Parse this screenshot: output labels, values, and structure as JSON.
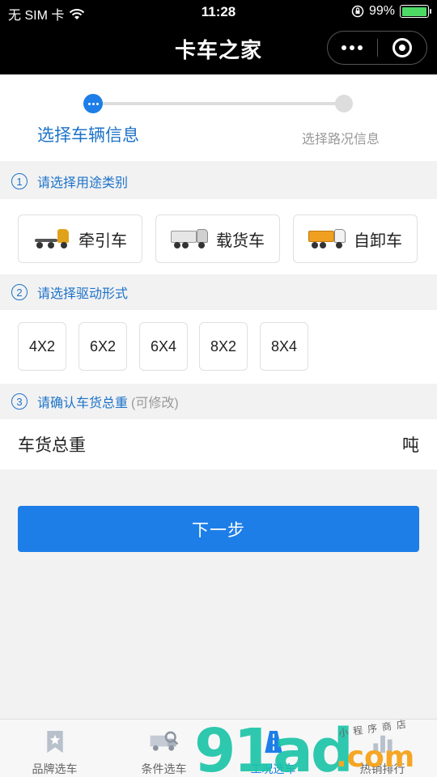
{
  "status_bar": {
    "carrier": "无 SIM 卡",
    "time": "11:28",
    "battery": "99%",
    "battery_level": 0.99
  },
  "nav": {
    "title": "卡车之家"
  },
  "steps": {
    "step1": "选择车辆信息",
    "step2": "选择路况信息",
    "current": 1
  },
  "section1": {
    "number": "①",
    "title": "请选择用途类别",
    "options": [
      {
        "label": "牵引车",
        "icon": "tractor-truck-icon"
      },
      {
        "label": "载货车",
        "icon": "cargo-truck-icon"
      },
      {
        "label": "自卸车",
        "icon": "dump-truck-icon"
      }
    ]
  },
  "section2": {
    "number": "②",
    "title": "请选择驱动形式",
    "options": [
      "4X2",
      "6X2",
      "6X4",
      "8X2",
      "8X4"
    ]
  },
  "section3": {
    "number": "③",
    "title": "请确认车货总重",
    "hint": "(可修改)",
    "field_label": "车货总重",
    "field_value": "",
    "unit": "吨"
  },
  "next_button": "下一步",
  "tabbar": [
    {
      "label": "品牌选车",
      "icon": "bookmark-star-icon"
    },
    {
      "label": "条件选车",
      "icon": "truck-search-icon"
    },
    {
      "label": "工况选车",
      "icon": "road-icon",
      "active": true
    },
    {
      "label": "热销排行",
      "icon": "ranking-icon"
    }
  ],
  "watermark": {
    "number": "91ad",
    "domain": ".com",
    "tagline": "小程序商店"
  },
  "colors": {
    "accent": "#1d7ee8",
    "text_accent": "#1d73c9",
    "nav_bg": "#000000",
    "page_bg": "#f2f2f2"
  }
}
